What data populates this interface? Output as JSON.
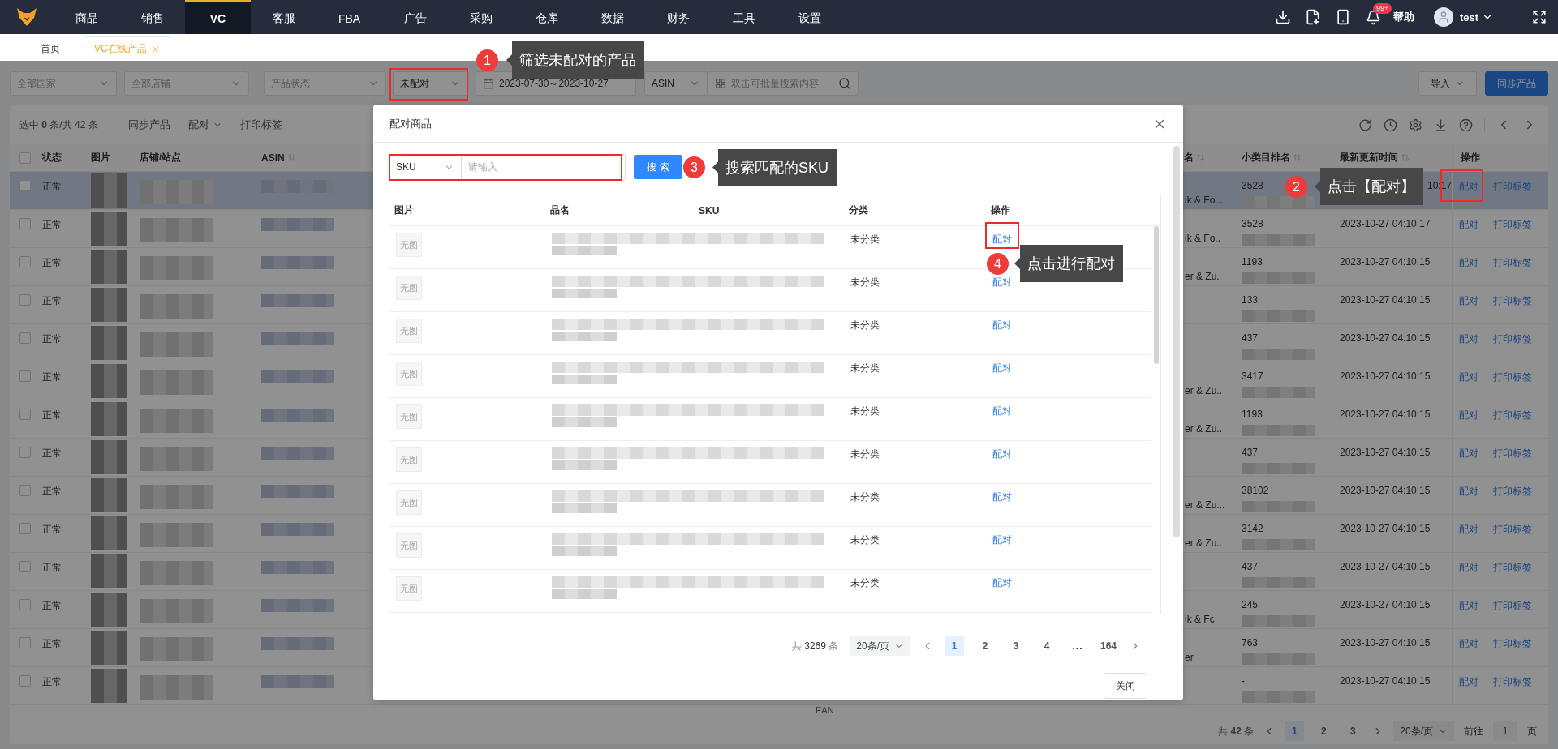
{
  "nav": {
    "menu": [
      {
        "label": "商品",
        "selected": false
      },
      {
        "label": "销售",
        "selected": false
      },
      {
        "label": "VC",
        "selected": true
      },
      {
        "label": "客服",
        "selected": false
      },
      {
        "label": "FBA",
        "selected": false
      },
      {
        "label": "广告",
        "selected": false
      },
      {
        "label": "采购",
        "selected": false
      },
      {
        "label": "仓库",
        "selected": false
      },
      {
        "label": "数据",
        "selected": false
      },
      {
        "label": "财务",
        "selected": false
      },
      {
        "label": "工具",
        "selected": false
      },
      {
        "label": "设置",
        "selected": false
      }
    ],
    "notification_count": "99+",
    "help": "帮助",
    "user": "test"
  },
  "tabs": [
    {
      "label": "首页",
      "selected": false,
      "closable": false
    },
    {
      "label": "VC在线产品",
      "selected": true,
      "closable": true
    }
  ],
  "filters": [
    {
      "kind": "select",
      "placeholder": "全部国家"
    },
    {
      "kind": "select",
      "placeholder": "全部店铺"
    },
    {
      "kind": "select",
      "placeholder": "产品状态"
    },
    {
      "kind": "select",
      "value": "未配对"
    },
    {
      "kind": "date_range",
      "value": "2023-07-30～2023-10-27"
    },
    {
      "kind": "select",
      "value": "ASIN"
    },
    {
      "kind": "search",
      "placeholder": "双击可批量搜索内容"
    }
  ],
  "actions": [
    {
      "label": "导入",
      "kind": "dropdown"
    },
    {
      "label": "同步产品",
      "kind": "primary"
    }
  ],
  "toolbar": {
    "selection": "选中 **0** 条/共 42 条",
    "items": [
      {
        "label": "同步产品",
        "kind": "plain"
      },
      {
        "label": "配对",
        "kind": "dropdown"
      },
      {
        "label": "打印标签",
        "kind": "plain"
      }
    ]
  },
  "table": {
    "select_all_checked": false,
    "columns": [
      {
        "label": "状态",
        "sortable": false
      },
      {
        "label": "图片",
        "sortable": false
      },
      {
        "label": "店铺/站点",
        "sortable": false
      },
      {
        "label": "ASIN",
        "sortable": true
      },
      {
        "label": "名",
        "sortable": true
      },
      {
        "label": "小类目排名",
        "sortable": true
      },
      {
        "label": "最新更新时间",
        "sortable": true
      },
      {
        "label": "操作",
        "sortable": false
      }
    ],
    "rows": [
      {
        "checked": false,
        "highlighted": true,
        "status": "正常",
        "column_5": "ik & Fo...",
        "rank": "3528",
        "updated": "10:17",
        "cut": true,
        "actions": [
          "配对",
          "打印标签"
        ]
      },
      {
        "checked": false,
        "highlighted": false,
        "status": "正常",
        "column_5": "ik & Fo..",
        "rank": "3528",
        "updated": "2023-10-27 04:10:17",
        "cut": false,
        "actions": [
          "配对",
          "打印标签"
        ]
      },
      {
        "checked": false,
        "highlighted": false,
        "status": "正常",
        "column_5": "er & Zu.",
        "rank": "1193",
        "updated": "2023-10-27 04:10:15",
        "cut": false,
        "actions": [
          "配对",
          "打印标签"
        ]
      },
      {
        "checked": false,
        "highlighted": false,
        "status": "正常",
        "rank": "133",
        "updated": "2023-10-27 04:10:15",
        "cut": false,
        "actions": [
          "配对",
          "打印标签"
        ]
      },
      {
        "checked": false,
        "highlighted": false,
        "status": "正常",
        "rank": "437",
        "updated": "2023-10-27 04:10:15",
        "cut": false,
        "actions": [
          "配对",
          "打印标签"
        ]
      },
      {
        "checked": false,
        "highlighted": false,
        "status": "正常",
        "column_5": "er & Zu..",
        "rank": "3417",
        "updated": "2023-10-27 04:10:15",
        "cut": false,
        "actions": [
          "配对",
          "打印标签"
        ]
      },
      {
        "checked": false,
        "highlighted": false,
        "status": "正常",
        "column_5": "er & Zu..",
        "rank": "1193",
        "updated": "2023-10-27 04:10:15",
        "cut": false,
        "actions": [
          "配对",
          "打印标签"
        ]
      },
      {
        "checked": false,
        "highlighted": false,
        "status": "正常",
        "rank": "437",
        "updated": "2023-10-27 04:10:15",
        "cut": false,
        "actions": [
          "配对",
          "打印标签"
        ]
      },
      {
        "checked": false,
        "highlighted": false,
        "status": "正常",
        "column_5": "er & Zu...",
        "rank": "38102",
        "updated": "2023-10-27 04:10:15",
        "cut": false,
        "actions": [
          "配对",
          "打印标签"
        ]
      },
      {
        "checked": false,
        "highlighted": false,
        "status": "正常",
        "column_5": "er & Zu..",
        "rank": "3142",
        "updated": "2023-10-27 04:10:15",
        "cut": false,
        "actions": [
          "配对",
          "打印标签"
        ]
      },
      {
        "checked": false,
        "highlighted": false,
        "status": "正常",
        "rank": "437",
        "updated": "2023-10-27 04:10:15",
        "cut": false,
        "actions": [
          "配对",
          "打印标签"
        ]
      },
      {
        "checked": false,
        "highlighted": false,
        "status": "正常",
        "column_5": "ik & Fc",
        "rank": "245",
        "updated": "2023-10-27 04:10:15",
        "cut": false,
        "actions": [
          "配对",
          "打印标签"
        ]
      },
      {
        "checked": false,
        "highlighted": false,
        "status": "正常",
        "column_5": "er",
        "rank": "763",
        "updated": "2023-10-27 04:10:15",
        "cut": false,
        "actions": [
          "配对",
          "打印标签"
        ]
      },
      {
        "checked": false,
        "highlighted": false,
        "status": "正常",
        "rank": "-",
        "updated": "2023-10-27 04:10:15",
        "cut": false,
        "actions": [
          "配对",
          "打印标签"
        ]
      }
    ],
    "footer_label": "EAN"
  },
  "pagination": {
    "total_prefix": "共",
    "total": "42",
    "total_suffix": "条",
    "pages": [
      {
        "label": "1",
        "kind": "page",
        "selected": true
      },
      {
        "label": "2",
        "kind": "page",
        "selected": false
      },
      {
        "label": "3",
        "kind": "page",
        "selected": false
      }
    ],
    "page_size": "20条/页",
    "goto_label": "前往",
    "goto_value": "1",
    "goto_suffix": "页"
  },
  "modal": {
    "title": "配对商品",
    "search_field": "SKU",
    "search_placeholder": "请输入",
    "search_button": "搜 索",
    "columns": [
      "图片",
      "品名",
      "SKU",
      "分类",
      "操作"
    ],
    "rows": [
      {
        "image": "无图",
        "category": "未分类",
        "action": "配对"
      },
      {
        "image": "无图",
        "category": "未分类",
        "action": "配对"
      },
      {
        "image": "无图",
        "category": "未分类",
        "action": "配对"
      },
      {
        "image": "无图",
        "category": "未分类",
        "action": "配对"
      },
      {
        "image": "无图",
        "category": "未分类",
        "action": "配对"
      },
      {
        "image": "无图",
        "category": "未分类",
        "action": "配对"
      },
      {
        "image": "无图",
        "category": "未分类",
        "action": "配对"
      },
      {
        "image": "无图",
        "category": "未分类",
        "action": "配对"
      },
      {
        "image": "无图",
        "category": "未分类",
        "action": "配对"
      }
    ],
    "pagination": {
      "total_prefix": "共",
      "total": "3269",
      "total_suffix": "条",
      "page_size": "20条/页",
      "pages": [
        {
          "label": "1",
          "kind": "page",
          "selected": true
        },
        {
          "label": "2",
          "kind": "page",
          "selected": false
        },
        {
          "label": "3",
          "kind": "page",
          "selected": false
        },
        {
          "label": "4",
          "kind": "page",
          "selected": false
        },
        {
          "label": "...",
          "kind": "ellipsis",
          "selected": false
        },
        {
          "label": "164",
          "kind": "page",
          "selected": false
        }
      ]
    },
    "close_button": "关闭"
  },
  "callouts": [
    {
      "number": "1",
      "text": "筛选未配对的产品"
    },
    {
      "number": "2",
      "text": "点击【配对】"
    },
    {
      "number": "3",
      "text": "搜索匹配的SKU"
    },
    {
      "number": "4",
      "text": "点击进行配对"
    }
  ]
}
